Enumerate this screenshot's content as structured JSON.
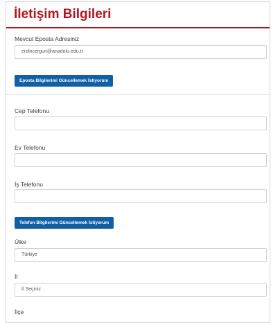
{
  "page": {
    "title": "İletişim Bilgileri"
  },
  "email": {
    "label": "Mevcut Eposta Adresiniz",
    "value": "erdincergun@anadolu.edu.tr",
    "update_button": "Eposta Bilgilerimi Güncellemek İstiyorum"
  },
  "phone": {
    "mobile_label": "Cep Telefonu",
    "mobile_value": "",
    "home_label": "Ev Telefonu",
    "home_value": "",
    "work_label": "İş Telefonu",
    "work_value": "",
    "update_button": "Telefon Bilgilerimi Güncellemek İstiyorum"
  },
  "address": {
    "country_label": "Ülke",
    "country_value": "Türkiye",
    "city_label": "İl",
    "city_value": "İl Seçiniz",
    "district_label": "İlçe"
  },
  "colors": {
    "title_red": "#b0171f",
    "button_blue": "#1160a6"
  }
}
